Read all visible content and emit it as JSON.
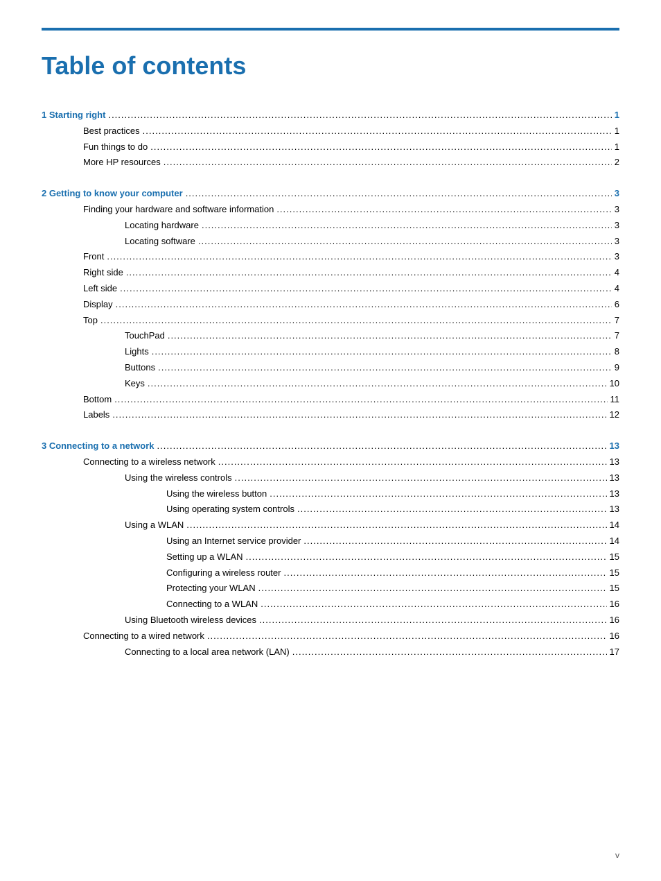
{
  "page": {
    "title": "Table of contents",
    "footer_label": "v"
  },
  "toc": {
    "sections": [
      {
        "id": "section-1",
        "level": 1,
        "text": "1  Starting right",
        "page": "1",
        "children": [
          {
            "level": 2,
            "text": "Best practices",
            "page": "1"
          },
          {
            "level": 2,
            "text": "Fun things to do",
            "page": "1"
          },
          {
            "level": 2,
            "text": "More HP resources",
            "page": "2"
          }
        ]
      },
      {
        "id": "section-2",
        "level": 1,
        "text": "2  Getting to know your computer",
        "page": "3",
        "children": [
          {
            "level": 2,
            "text": "Finding your hardware and software information",
            "page": "3",
            "children": [
              {
                "level": 3,
                "text": "Locating hardware",
                "page": "3"
              },
              {
                "level": 3,
                "text": "Locating software",
                "page": "3"
              }
            ]
          },
          {
            "level": 2,
            "text": "Front",
            "page": "3"
          },
          {
            "level": 2,
            "text": "Right side",
            "page": "4"
          },
          {
            "level": 2,
            "text": "Left side",
            "page": "4"
          },
          {
            "level": 2,
            "text": "Display",
            "page": "6"
          },
          {
            "level": 2,
            "text": "Top",
            "page": "7",
            "children": [
              {
                "level": 3,
                "text": "TouchPad",
                "page": "7"
              },
              {
                "level": 3,
                "text": "Lights",
                "page": "8"
              },
              {
                "level": 3,
                "text": "Buttons",
                "page": "9"
              },
              {
                "level": 3,
                "text": "Keys",
                "page": "10"
              }
            ]
          },
          {
            "level": 2,
            "text": "Bottom",
            "page": "11"
          },
          {
            "level": 2,
            "text": "Labels",
            "page": "12"
          }
        ]
      },
      {
        "id": "section-3",
        "level": 1,
        "text": "3  Connecting to a network",
        "page": "13",
        "children": [
          {
            "level": 2,
            "text": "Connecting to a wireless network",
            "page": "13",
            "children": [
              {
                "level": 3,
                "text": "Using the wireless controls",
                "page": "13",
                "children": [
                  {
                    "level": 4,
                    "text": "Using the wireless button",
                    "page": "13"
                  },
                  {
                    "level": 4,
                    "text": "Using operating system controls",
                    "page": "13"
                  }
                ]
              },
              {
                "level": 3,
                "text": "Using a WLAN",
                "page": "14",
                "children": [
                  {
                    "level": 4,
                    "text": "Using an Internet service provider",
                    "page": "14"
                  },
                  {
                    "level": 4,
                    "text": "Setting up a WLAN",
                    "page": "15"
                  },
                  {
                    "level": 4,
                    "text": "Configuring a wireless router",
                    "page": "15"
                  },
                  {
                    "level": 4,
                    "text": "Protecting your WLAN",
                    "page": "15"
                  },
                  {
                    "level": 4,
                    "text": "Connecting to a WLAN",
                    "page": "16"
                  }
                ]
              },
              {
                "level": 3,
                "text": "Using Bluetooth wireless devices",
                "page": "16"
              }
            ]
          },
          {
            "level": 2,
            "text": "Connecting to a wired network",
            "page": "16",
            "children": [
              {
                "level": 3,
                "text": "Connecting to a local area network (LAN)",
                "page": "17"
              }
            ]
          }
        ]
      }
    ]
  }
}
